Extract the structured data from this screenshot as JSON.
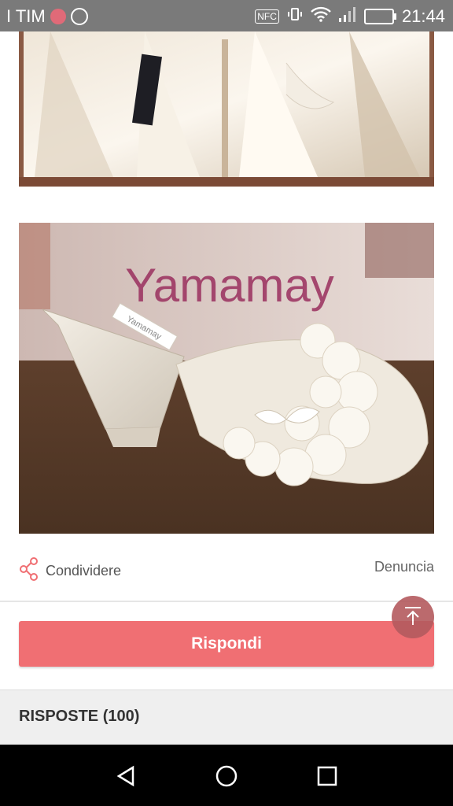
{
  "status_bar": {
    "carrier": "I TIM",
    "time": "21:44",
    "icons": [
      "notification-icon",
      "whatsapp-icon",
      "nfc-icon",
      "vibrate-icon",
      "wifi-icon",
      "signal-icon",
      "battery-icon"
    ],
    "nfc_label": "NFC"
  },
  "photos": [
    {
      "name": "wedding-dress-box-photo"
    },
    {
      "name": "bridal-slipper-photo",
      "brand_text": "Yamamay",
      "tag_text": "Yamamay"
    }
  ],
  "actions": {
    "share_label": "Condividere",
    "report_label": "Denuncia"
  },
  "reply_button": {
    "label": "Rispondi"
  },
  "answers": {
    "title": "RISPOSTE (100)"
  },
  "colors": {
    "accent": "#f06f73",
    "status_bar": "#7a7a7a",
    "scroll_top": "#b45a5e"
  },
  "nav_bar": {
    "icons": [
      "back-icon",
      "home-icon",
      "recents-icon"
    ]
  }
}
